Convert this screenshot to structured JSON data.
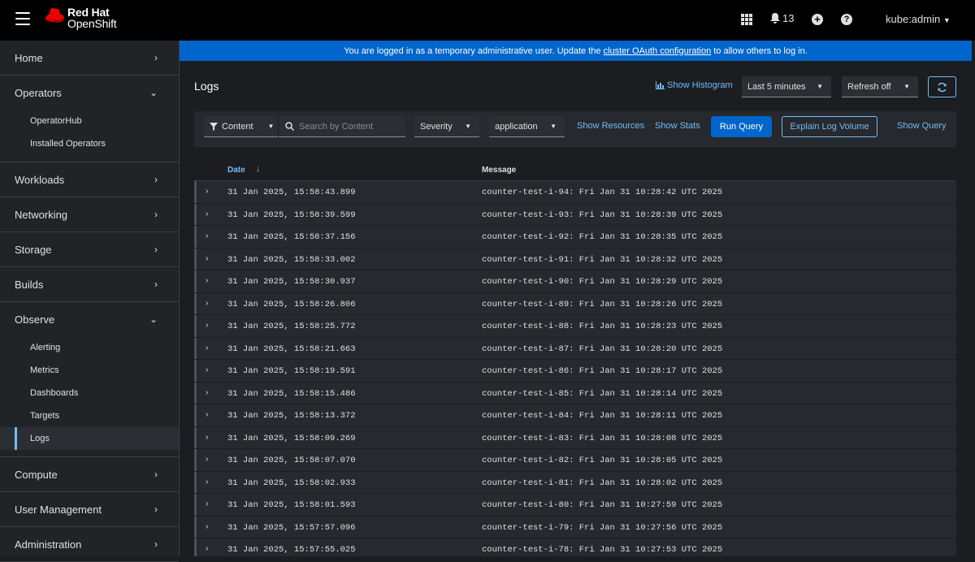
{
  "brand": {
    "line1": "Red Hat",
    "line2": "OpenShift"
  },
  "masthead": {
    "notifications_count": "13",
    "user": "kube:admin"
  },
  "sidebar": {
    "sections": [
      {
        "label": "Home",
        "expanded": false,
        "items": []
      },
      {
        "label": "Operators",
        "expanded": true,
        "items": [
          "OperatorHub",
          "Installed Operators"
        ]
      },
      {
        "label": "Workloads",
        "expanded": false,
        "items": []
      },
      {
        "label": "Networking",
        "expanded": false,
        "items": []
      },
      {
        "label": "Storage",
        "expanded": false,
        "items": []
      },
      {
        "label": "Builds",
        "expanded": false,
        "items": []
      },
      {
        "label": "Observe",
        "expanded": true,
        "items": [
          "Alerting",
          "Metrics",
          "Dashboards",
          "Targets",
          "Logs"
        ],
        "active": "Logs"
      },
      {
        "label": "Compute",
        "expanded": false,
        "items": []
      },
      {
        "label": "User Management",
        "expanded": false,
        "items": []
      },
      {
        "label": "Administration",
        "expanded": false,
        "items": []
      }
    ]
  },
  "banner": {
    "prefix": "You are logged in as a temporary administrative user. Update the",
    "link": "cluster OAuth configuration",
    "suffix": "to allow others to log in."
  },
  "page": {
    "title": "Logs",
    "show_histogram": "Show Histogram",
    "time_range": "Last 5 minutes",
    "refresh": "Refresh off"
  },
  "toolbar": {
    "filter_type": "Content",
    "search_placeholder": "Search by Content",
    "severity": "Severity",
    "tenant": "application",
    "show_resources": "Show Resources",
    "show_stats": "Show Stats",
    "run_query": "Run Query",
    "explain": "Explain Log Volume",
    "show_query": "Show Query"
  },
  "table": {
    "columns": {
      "date": "Date",
      "message": "Message"
    },
    "rows": [
      {
        "date": "31 Jan 2025, 15:58:43.899",
        "message": "counter-test-i-94: Fri Jan 31 10:28:42 UTC 2025"
      },
      {
        "date": "31 Jan 2025, 15:58:39.599",
        "message": "counter-test-i-93: Fri Jan 31 10:28:39 UTC 2025"
      },
      {
        "date": "31 Jan 2025, 15:58:37.156",
        "message": "counter-test-i-92: Fri Jan 31 10:28:35 UTC 2025"
      },
      {
        "date": "31 Jan 2025, 15:58:33.002",
        "message": "counter-test-i-91: Fri Jan 31 10:28:32 UTC 2025"
      },
      {
        "date": "31 Jan 2025, 15:58:30.937",
        "message": "counter-test-i-90: Fri Jan 31 10:28:29 UTC 2025"
      },
      {
        "date": "31 Jan 2025, 15:58:26.806",
        "message": "counter-test-i-89: Fri Jan 31 10:28:26 UTC 2025"
      },
      {
        "date": "31 Jan 2025, 15:58:25.772",
        "message": "counter-test-i-88: Fri Jan 31 10:28:23 UTC 2025"
      },
      {
        "date": "31 Jan 2025, 15:58:21.663",
        "message": "counter-test-i-87: Fri Jan 31 10:28:20 UTC 2025"
      },
      {
        "date": "31 Jan 2025, 15:58:19.591",
        "message": "counter-test-i-86: Fri Jan 31 10:28:17 UTC 2025"
      },
      {
        "date": "31 Jan 2025, 15:58:15.486",
        "message": "counter-test-i-85: Fri Jan 31 10:28:14 UTC 2025"
      },
      {
        "date": "31 Jan 2025, 15:58:13.372",
        "message": "counter-test-i-84: Fri Jan 31 10:28:11 UTC 2025"
      },
      {
        "date": "31 Jan 2025, 15:58:09.269",
        "message": "counter-test-i-83: Fri Jan 31 10:28:08 UTC 2025"
      },
      {
        "date": "31 Jan 2025, 15:58:07.070",
        "message": "counter-test-i-82: Fri Jan 31 10:28:05 UTC 2025"
      },
      {
        "date": "31 Jan 2025, 15:58:02.933",
        "message": "counter-test-i-81: Fri Jan 31 10:28:02 UTC 2025"
      },
      {
        "date": "31 Jan 2025, 15:58:01.593",
        "message": "counter-test-i-80: Fri Jan 31 10:27:59 UTC 2025"
      },
      {
        "date": "31 Jan 2025, 15:57:57.096",
        "message": "counter-test-i-79: Fri Jan 31 10:27:56 UTC 2025"
      },
      {
        "date": "31 Jan 2025, 15:57:55.025",
        "message": "counter-test-i-78: Fri Jan 31 10:27:53 UTC 2025"
      }
    ]
  },
  "icons": {
    "hamburger": "hamburger-icon",
    "apps": "grid-icon",
    "notifications": "bell-icon",
    "add": "plus-circle-icon",
    "help": "question-circle-icon",
    "histogram": "bar-chart-icon",
    "sync": "sync-icon",
    "filter": "filter-icon",
    "search": "search-icon",
    "expand": "chevron-right-icon",
    "sort": "sort-down-icon"
  },
  "colors": {
    "accent": "#73bcf7",
    "primary": "#0066cc",
    "brand_red": "#ee0000"
  }
}
